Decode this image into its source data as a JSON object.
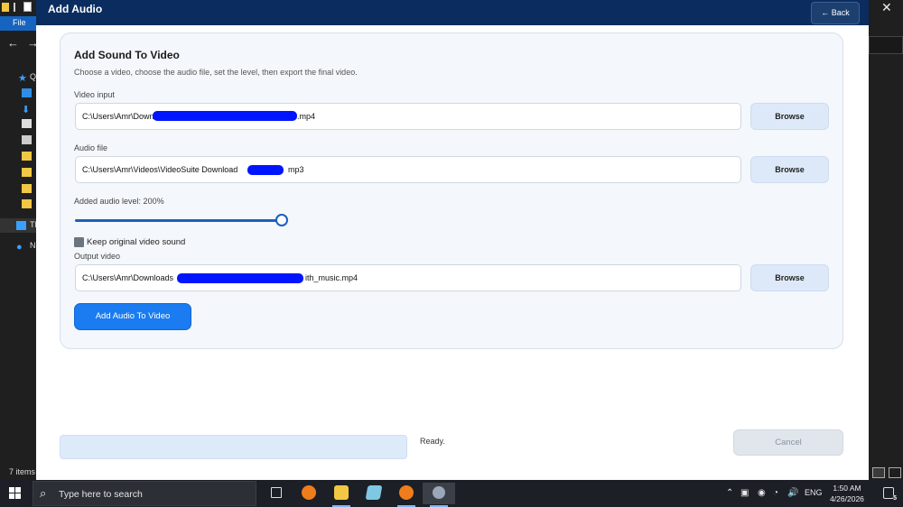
{
  "window": {
    "title": "Add Audio",
    "back_label": "← Back"
  },
  "panel": {
    "title": "Add Sound To Video",
    "subtitle": "Choose a video, choose the audio file, set the level, then export the final video."
  },
  "video_input": {
    "label": "Video input",
    "value_start": "C:\\Users\\Amr\\Downl",
    "value_end": ".mp4",
    "browse_label": "Browse"
  },
  "audio_file": {
    "label": "Audio file",
    "value_start": "C:\\Users\\Amr\\Videos\\VideoSuite Download",
    "value_end": "mp3",
    "browse_label": "Browse"
  },
  "audio_level": {
    "label": "Added audio level: 200%",
    "fraction": 1.0
  },
  "keep_original": {
    "label": "Keep original video sound",
    "checked": true
  },
  "output_video": {
    "label": "Output video",
    "value_start": "C:\\Users\\Amr\\Downloads",
    "value_end": "ith_music.mp4",
    "browse_label": "Browse"
  },
  "actions": {
    "primary_label": "Add Audio To Video",
    "cancel_label": "Cancel",
    "status": "Ready.",
    "progress_fraction": 0
  },
  "background": {
    "file_tab": "File",
    "item_count": "7 items"
  },
  "taskbar": {
    "search_placeholder": "Type here to search",
    "lang": "ENG",
    "time": "1:50 AM",
    "date": "4/26/2026",
    "notification_count": "5"
  },
  "colors": {
    "titlebar": "#0b2c5e",
    "accent": "#1a7cf0",
    "redaction": "#0015ff"
  }
}
